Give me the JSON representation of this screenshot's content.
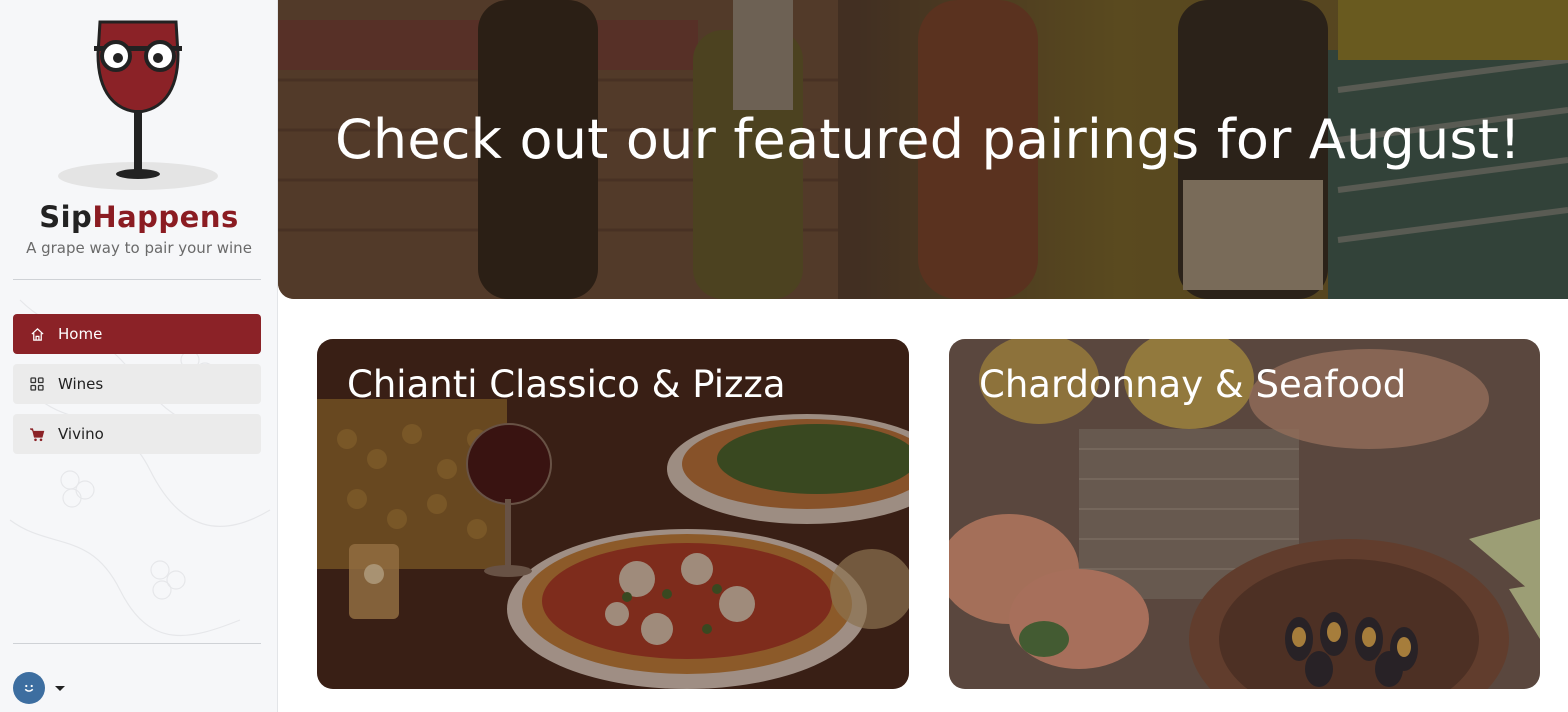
{
  "brand": {
    "name_part1": "Sip",
    "name_part2": "Happens",
    "tagline": "A grape way to pair your wine",
    "accent_color": "#8b2227"
  },
  "sidebar": {
    "items": [
      {
        "label": "Home",
        "icon": "home-icon",
        "active": true
      },
      {
        "label": "Wines",
        "icon": "grid-icon",
        "active": false
      },
      {
        "label": "Vivino",
        "icon": "cart-icon",
        "active": false
      }
    ]
  },
  "user": {
    "avatar_icon": "smiley-icon",
    "menu_icon": "caret-down-icon"
  },
  "hero": {
    "title": "Check out our featured pairings for August!"
  },
  "pairings": [
    {
      "title": "Chianti Classico & Pizza"
    },
    {
      "title": "Chardonnay & Seafood"
    }
  ]
}
